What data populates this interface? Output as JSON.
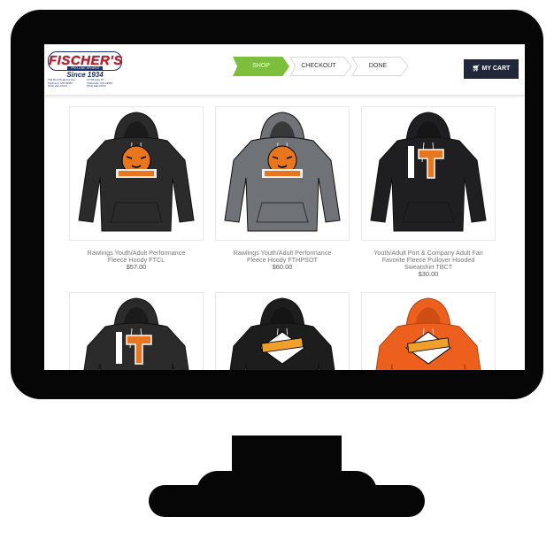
{
  "brand": {
    "name": "FISCHER'S",
    "tagline": "PRO-LINE SPORTS",
    "since": "Since 1934",
    "address_left": [
      "736 First Piedmont Ave",
      "Piedmont, MO 63957",
      "(573) 223-XXXX"
    ],
    "address_right": [
      "17735 Hwy 67",
      "Clarksville, MO 63957",
      "(573) 649-XXXX"
    ]
  },
  "checkout_steps": [
    {
      "label": "SHOP",
      "active": true
    },
    {
      "label": "CHECKOUT",
      "active": false
    },
    {
      "label": "DONE",
      "active": false
    }
  ],
  "cart_button": {
    "label": "MY CART",
    "icon": "cart-icon"
  },
  "products": [
    {
      "name_line1": "Rawlings Youth/Adult Performance",
      "name_line2": "Fleece Hoody FTCL",
      "name_line3": "",
      "price": "$57.00",
      "hoodie_color": "#2b2b2b",
      "graphic": "tiger-head"
    },
    {
      "name_line1": "Rawlings Youth/Adult Performance",
      "name_line2": "Fleece Hoody FTHPSOT",
      "name_line3": "",
      "price": "$60.00",
      "hoodie_color": "#6f7378",
      "graphic": "tiger-head"
    },
    {
      "name_line1": "Youth/Adult Port & Company Adult Fan",
      "name_line2": "Favorite Fleece Pullover Hooded",
      "name_line3": "Sweatshirt TBCT",
      "price": "$30.00",
      "hoodie_color": "#1f1f22",
      "graphic": "tigers-t"
    },
    {
      "name_line1": "",
      "name_line2": "",
      "name_line3": "",
      "price": "",
      "hoodie_color": "#2b2b2b",
      "graphic": "tigers-t"
    },
    {
      "name_line1": "",
      "name_line2": "",
      "name_line3": "",
      "price": "",
      "hoodie_color": "#1d1d1d",
      "graphic": "tigers-diamond"
    },
    {
      "name_line1": "",
      "name_line2": "",
      "name_line3": "",
      "price": "",
      "hoodie_color": "#ec5f1c",
      "graphic": "tigers-diamond"
    }
  ]
}
